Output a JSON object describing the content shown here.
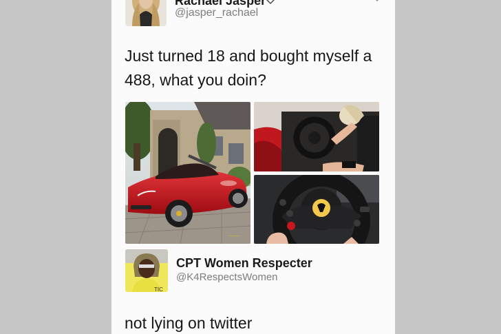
{
  "tweet": {
    "author_name": "Rachael Jasper",
    "author_handle": "@jasper_rachael",
    "text": "Just turned 18 and bought myself a 488, what you doin?",
    "photos": [
      {
        "subject": "red Ferrari convertible parked in front of a stone house"
      },
      {
        "subject": "woman driving the car, interior view"
      },
      {
        "subject": "steering wheel with Ferrari badge"
      }
    ]
  },
  "reply": {
    "author_name": "CPT Women Respecter",
    "author_handle": "@K4RespectsWomen",
    "text": "not lying on twitter"
  },
  "colors": {
    "page_bg": "#c6c6c6",
    "card_bg": "#fbfbfb",
    "ferrari_red": "#c8141b",
    "text": "#161616",
    "handle": "#7c7c7c"
  }
}
